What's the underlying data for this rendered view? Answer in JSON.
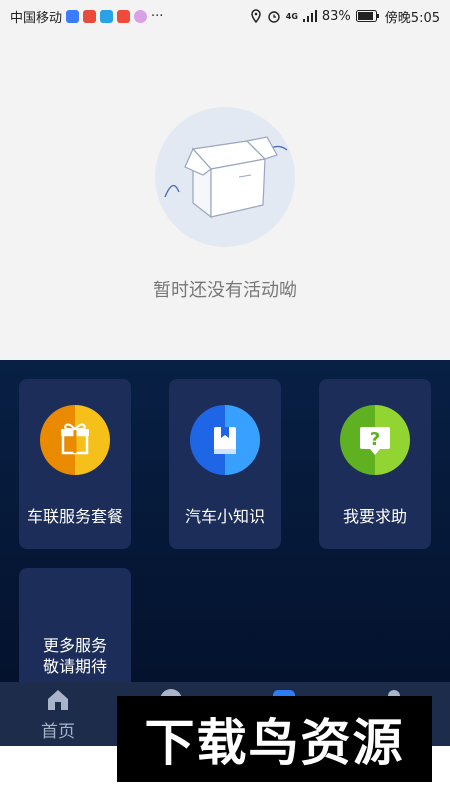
{
  "status": {
    "carrier": "中国移动",
    "network": "4G",
    "battery": "83%",
    "time": "傍晚5:05",
    "more_symbol": "···"
  },
  "empty": {
    "message": "暂时还没有活动呦"
  },
  "services": [
    {
      "label": "车联服务套餐",
      "icon": "gift-icon",
      "color_start": "#f7b500",
      "color_end": "#e38b00"
    },
    {
      "label": "汽车小知识",
      "icon": "book-icon",
      "color_start": "#2e8cff",
      "color_end": "#1d5fe0"
    },
    {
      "label": "我要求助",
      "icon": "help-icon",
      "color_start": "#8ccf2e",
      "color_end": "#5aa81f"
    }
  ],
  "more_service": {
    "line1": "更多服务",
    "line2": "敬请期待"
  },
  "tabs": [
    {
      "label": "首页",
      "icon": "home-icon"
    }
  ],
  "watermark": "下载鸟资源"
}
